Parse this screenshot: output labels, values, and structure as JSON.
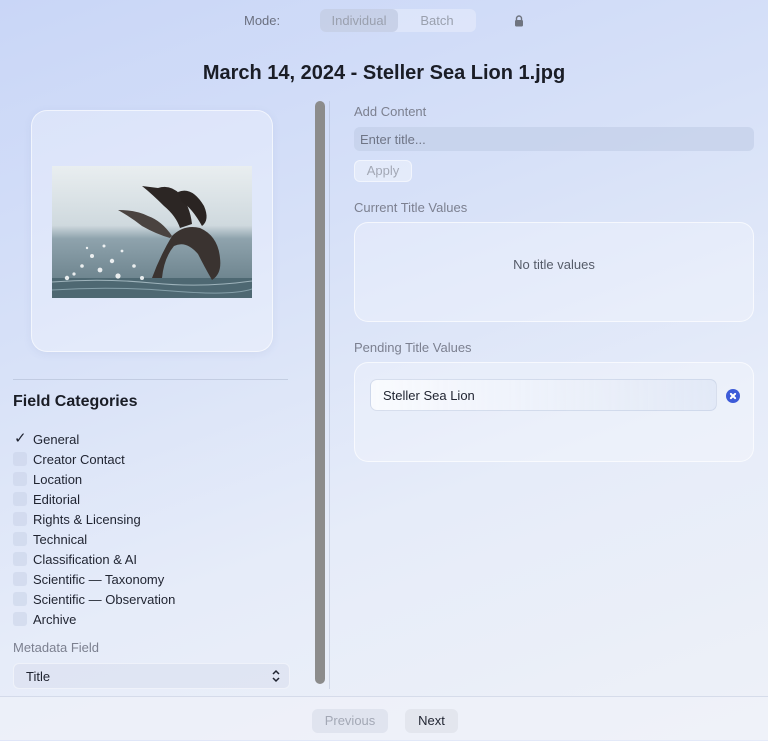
{
  "mode": {
    "label": "Mode:",
    "options": [
      "Individual",
      "Batch"
    ],
    "selected": "Individual",
    "locked_icon": "lock-icon"
  },
  "file_title": "March 14, 2024 - Steller Sea Lion 1.jpg",
  "sidebar": {
    "section_title": "Field Categories",
    "categories": [
      {
        "label": "General",
        "checked": true
      },
      {
        "label": "Creator Contact",
        "checked": false
      },
      {
        "label": "Location",
        "checked": false
      },
      {
        "label": "Editorial",
        "checked": false
      },
      {
        "label": "Rights & Licensing",
        "checked": false
      },
      {
        "label": "Technical",
        "checked": false
      },
      {
        "label": "Classification & AI",
        "checked": false
      },
      {
        "label": "Scientific — Taxonomy",
        "checked": false
      },
      {
        "label": "Scientific — Observation",
        "checked": false
      },
      {
        "label": "Archive",
        "checked": false
      }
    ],
    "metadata_field_label": "Metadata Field",
    "metadata_field_value": "Title"
  },
  "editor": {
    "add_content_label": "Add Content",
    "input_placeholder": "Enter title...",
    "input_value": "",
    "apply_label": "Apply",
    "current_label": "Current Title Values",
    "current_empty": "No title values",
    "pending_label": "Pending Title Values",
    "pending_values": [
      "Steller Sea Lion"
    ]
  },
  "footer": {
    "previous_label": "Previous",
    "next_label": "Next"
  },
  "colors": {
    "accent": "#3d5bd8",
    "scrollbar": "#8c8c8c"
  }
}
